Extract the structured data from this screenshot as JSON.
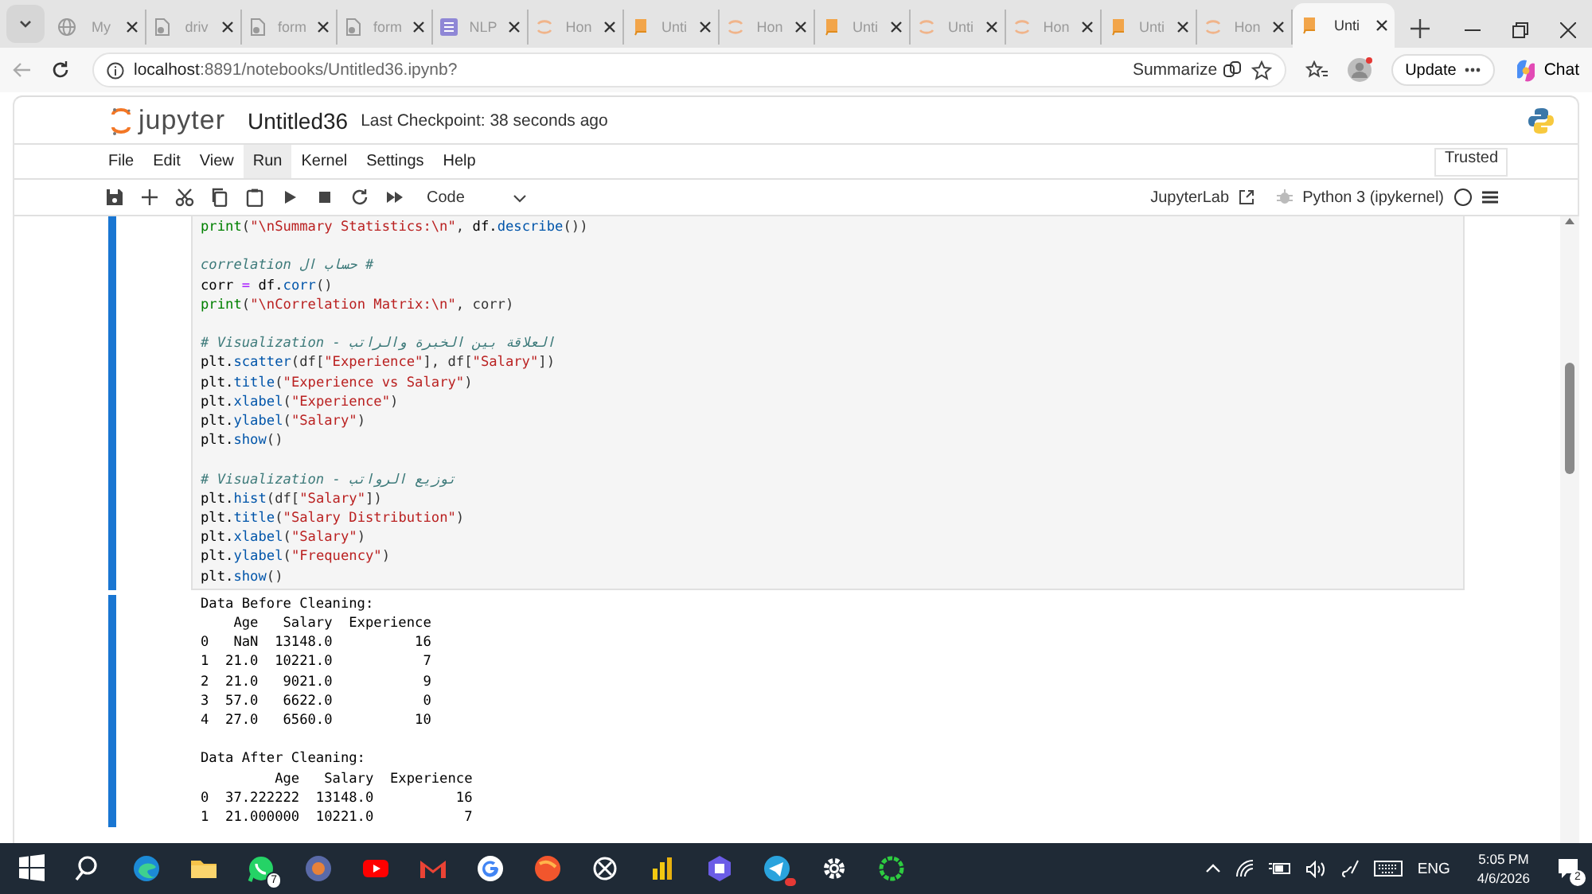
{
  "browser": {
    "tabs": [
      {
        "label": "My",
        "kind": "globe",
        "selected": false
      },
      {
        "label": "driv",
        "kind": "file",
        "selected": false
      },
      {
        "label": "form",
        "kind": "file",
        "selected": false
      },
      {
        "label": "form",
        "kind": "file",
        "selected": false
      },
      {
        "label": "NLP",
        "kind": "list",
        "selected": false
      },
      {
        "label": "Hon",
        "kind": "ring",
        "selected": false
      },
      {
        "label": "Unti",
        "kind": "book",
        "selected": false
      },
      {
        "label": "Hon",
        "kind": "ring",
        "selected": false
      },
      {
        "label": "Unti",
        "kind": "book",
        "selected": false
      },
      {
        "label": "Unti",
        "kind": "ring",
        "selected": false
      },
      {
        "label": "Hon",
        "kind": "ring",
        "selected": false
      },
      {
        "label": "Unti",
        "kind": "book",
        "selected": false
      },
      {
        "label": "Hon",
        "kind": "ring",
        "selected": false
      },
      {
        "label": "Unti",
        "kind": "book",
        "selected": true
      }
    ],
    "url": "**localhost**:8891/notebooks/Untitled36.ipynb?",
    "summarize": "Summarize",
    "update": "Update",
    "chat": "Chat"
  },
  "jupyter": {
    "logo": "jupyter",
    "notebook_name": "Untitled36",
    "checkpoint": "Last Checkpoint: 38 seconds ago",
    "menu": [
      {
        "label": "File",
        "selected": false
      },
      {
        "label": "Edit",
        "selected": false
      },
      {
        "label": "View",
        "selected": false
      },
      {
        "label": "Run",
        "selected": true
      },
      {
        "label": "Kernel",
        "selected": false
      },
      {
        "label": "Settings",
        "selected": false
      },
      {
        "label": "Help",
        "selected": false
      }
    ],
    "trusted": "Trusted",
    "cell_type": "Code",
    "jupyterlab": "JupyterLab",
    "kernel": "Python 3 (ipykernel)"
  },
  "code_cell": {
    "blocks": [
      [
        [
          {
            "kind": "builtin",
            "text": "print"
          },
          {
            "kind": "punct",
            "text": "("
          },
          {
            "kind": "string",
            "text": "\"\\nSummary Statistics:\\n\""
          },
          {
            "kind": "punct",
            "text": ", "
          },
          {
            "kind": "name",
            "text": "df."
          },
          {
            "kind": "attr",
            "text": "describe"
          },
          {
            "kind": "punct",
            "text": "())"
          }
        ]
      ],
      [
        [
          {
            "kind": "comment",
            "text": "# حساب ال correlation"
          }
        ],
        [
          {
            "kind": "name",
            "text": "corr "
          },
          {
            "kind": "op",
            "text": "="
          },
          {
            "kind": "name",
            "text": " df."
          },
          {
            "kind": "attr",
            "text": "corr"
          },
          {
            "kind": "punct",
            "text": "()"
          }
        ],
        [
          {
            "kind": "builtin",
            "text": "print"
          },
          {
            "kind": "punct",
            "text": "("
          },
          {
            "kind": "string",
            "text": "\"\\nCorrelation Matrix:\\n\""
          },
          {
            "kind": "punct",
            "text": ", corr)"
          }
        ]
      ],
      [
        [
          {
            "kind": "comment",
            "text": "# Visualization - العلاقة بين الخبرة والراتب"
          }
        ],
        [
          {
            "kind": "name",
            "text": "plt."
          },
          {
            "kind": "attr",
            "text": "scatter"
          },
          {
            "kind": "punct",
            "text": "(df["
          },
          {
            "kind": "string",
            "text": "\"Experience\""
          },
          {
            "kind": "punct",
            "text": "], df["
          },
          {
            "kind": "string",
            "text": "\"Salary\""
          },
          {
            "kind": "punct",
            "text": "])"
          }
        ],
        [
          {
            "kind": "name",
            "text": "plt."
          },
          {
            "kind": "attr",
            "text": "title"
          },
          {
            "kind": "punct",
            "text": "("
          },
          {
            "kind": "string",
            "text": "\"Experience vs Salary\""
          },
          {
            "kind": "punct",
            "text": ")"
          }
        ],
        [
          {
            "kind": "name",
            "text": "plt."
          },
          {
            "kind": "attr",
            "text": "xlabel"
          },
          {
            "kind": "punct",
            "text": "("
          },
          {
            "kind": "string",
            "text": "\"Experience\""
          },
          {
            "kind": "punct",
            "text": ")"
          }
        ],
        [
          {
            "kind": "name",
            "text": "plt."
          },
          {
            "kind": "attr",
            "text": "ylabel"
          },
          {
            "kind": "punct",
            "text": "("
          },
          {
            "kind": "string",
            "text": "\"Salary\""
          },
          {
            "kind": "punct",
            "text": ")"
          }
        ],
        [
          {
            "kind": "name",
            "text": "plt."
          },
          {
            "kind": "attr",
            "text": "show"
          },
          {
            "kind": "punct",
            "text": "()"
          }
        ]
      ],
      [
        [
          {
            "kind": "comment",
            "text": "# Visualization - توزيع الرواتب"
          }
        ],
        [
          {
            "kind": "name",
            "text": "plt."
          },
          {
            "kind": "attr",
            "text": "hist"
          },
          {
            "kind": "punct",
            "text": "(df["
          },
          {
            "kind": "string",
            "text": "\"Salary\""
          },
          {
            "kind": "punct",
            "text": "])"
          }
        ],
        [
          {
            "kind": "name",
            "text": "plt."
          },
          {
            "kind": "attr",
            "text": "title"
          },
          {
            "kind": "punct",
            "text": "("
          },
          {
            "kind": "string",
            "text": "\"Salary Distribution\""
          },
          {
            "kind": "punct",
            "text": ")"
          }
        ],
        [
          {
            "kind": "name",
            "text": "plt."
          },
          {
            "kind": "attr",
            "text": "xlabel"
          },
          {
            "kind": "punct",
            "text": "("
          },
          {
            "kind": "string",
            "text": "\"Salary\""
          },
          {
            "kind": "punct",
            "text": ")"
          }
        ],
        [
          {
            "kind": "name",
            "text": "plt."
          },
          {
            "kind": "attr",
            "text": "ylabel"
          },
          {
            "kind": "punct",
            "text": "("
          },
          {
            "kind": "string",
            "text": "\"Frequency\""
          },
          {
            "kind": "punct",
            "text": ")"
          }
        ],
        [
          {
            "kind": "name",
            "text": "plt."
          },
          {
            "kind": "attr",
            "text": "show"
          },
          {
            "kind": "punct",
            "text": "()"
          }
        ]
      ]
    ]
  },
  "output_cell": {
    "blocks": [
      [
        "Data Before Cleaning:",
        "    Age   Salary  Experience",
        "0   NaN  13148.0          16",
        "1  21.0  10221.0           7",
        "2  21.0   9021.0           9",
        "3  57.0   6622.0           0",
        "4  27.0   6560.0          10"
      ],
      [
        "Data After Cleaning:",
        "         Age   Salary  Experience",
        "0  37.222222  13148.0          16",
        "1  21.000000  10221.0           7"
      ]
    ]
  },
  "taskbar": {
    "app_badge": "7",
    "language": "ENG",
    "time": "5:05 PM",
    "date": "4/6/2026",
    "notifications": "2"
  }
}
